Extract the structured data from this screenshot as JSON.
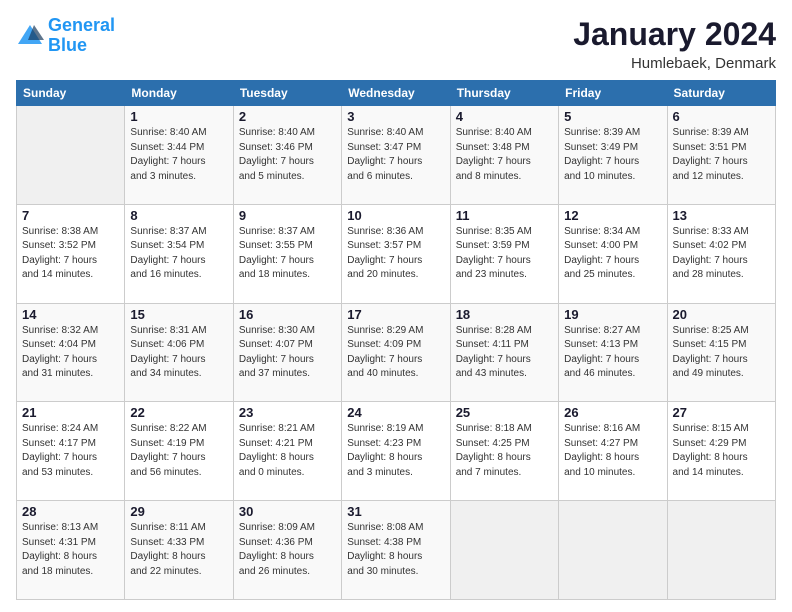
{
  "logo": {
    "line1": "General",
    "line2": "Blue"
  },
  "header": {
    "title": "January 2024",
    "location": "Humlebaek, Denmark"
  },
  "columns": [
    "Sunday",
    "Monday",
    "Tuesday",
    "Wednesday",
    "Thursday",
    "Friday",
    "Saturday"
  ],
  "weeks": [
    [
      {
        "day": "",
        "info": ""
      },
      {
        "day": "1",
        "info": "Sunrise: 8:40 AM\nSunset: 3:44 PM\nDaylight: 7 hours\nand 3 minutes."
      },
      {
        "day": "2",
        "info": "Sunrise: 8:40 AM\nSunset: 3:46 PM\nDaylight: 7 hours\nand 5 minutes."
      },
      {
        "day": "3",
        "info": "Sunrise: 8:40 AM\nSunset: 3:47 PM\nDaylight: 7 hours\nand 6 minutes."
      },
      {
        "day": "4",
        "info": "Sunrise: 8:40 AM\nSunset: 3:48 PM\nDaylight: 7 hours\nand 8 minutes."
      },
      {
        "day": "5",
        "info": "Sunrise: 8:39 AM\nSunset: 3:49 PM\nDaylight: 7 hours\nand 10 minutes."
      },
      {
        "day": "6",
        "info": "Sunrise: 8:39 AM\nSunset: 3:51 PM\nDaylight: 7 hours\nand 12 minutes."
      }
    ],
    [
      {
        "day": "7",
        "info": "Sunrise: 8:38 AM\nSunset: 3:52 PM\nDaylight: 7 hours\nand 14 minutes."
      },
      {
        "day": "8",
        "info": "Sunrise: 8:37 AM\nSunset: 3:54 PM\nDaylight: 7 hours\nand 16 minutes."
      },
      {
        "day": "9",
        "info": "Sunrise: 8:37 AM\nSunset: 3:55 PM\nDaylight: 7 hours\nand 18 minutes."
      },
      {
        "day": "10",
        "info": "Sunrise: 8:36 AM\nSunset: 3:57 PM\nDaylight: 7 hours\nand 20 minutes."
      },
      {
        "day": "11",
        "info": "Sunrise: 8:35 AM\nSunset: 3:59 PM\nDaylight: 7 hours\nand 23 minutes."
      },
      {
        "day": "12",
        "info": "Sunrise: 8:34 AM\nSunset: 4:00 PM\nDaylight: 7 hours\nand 25 minutes."
      },
      {
        "day": "13",
        "info": "Sunrise: 8:33 AM\nSunset: 4:02 PM\nDaylight: 7 hours\nand 28 minutes."
      }
    ],
    [
      {
        "day": "14",
        "info": "Sunrise: 8:32 AM\nSunset: 4:04 PM\nDaylight: 7 hours\nand 31 minutes."
      },
      {
        "day": "15",
        "info": "Sunrise: 8:31 AM\nSunset: 4:06 PM\nDaylight: 7 hours\nand 34 minutes."
      },
      {
        "day": "16",
        "info": "Sunrise: 8:30 AM\nSunset: 4:07 PM\nDaylight: 7 hours\nand 37 minutes."
      },
      {
        "day": "17",
        "info": "Sunrise: 8:29 AM\nSunset: 4:09 PM\nDaylight: 7 hours\nand 40 minutes."
      },
      {
        "day": "18",
        "info": "Sunrise: 8:28 AM\nSunset: 4:11 PM\nDaylight: 7 hours\nand 43 minutes."
      },
      {
        "day": "19",
        "info": "Sunrise: 8:27 AM\nSunset: 4:13 PM\nDaylight: 7 hours\nand 46 minutes."
      },
      {
        "day": "20",
        "info": "Sunrise: 8:25 AM\nSunset: 4:15 PM\nDaylight: 7 hours\nand 49 minutes."
      }
    ],
    [
      {
        "day": "21",
        "info": "Sunrise: 8:24 AM\nSunset: 4:17 PM\nDaylight: 7 hours\nand 53 minutes."
      },
      {
        "day": "22",
        "info": "Sunrise: 8:22 AM\nSunset: 4:19 PM\nDaylight: 7 hours\nand 56 minutes."
      },
      {
        "day": "23",
        "info": "Sunrise: 8:21 AM\nSunset: 4:21 PM\nDaylight: 8 hours\nand 0 minutes."
      },
      {
        "day": "24",
        "info": "Sunrise: 8:19 AM\nSunset: 4:23 PM\nDaylight: 8 hours\nand 3 minutes."
      },
      {
        "day": "25",
        "info": "Sunrise: 8:18 AM\nSunset: 4:25 PM\nDaylight: 8 hours\nand 7 minutes."
      },
      {
        "day": "26",
        "info": "Sunrise: 8:16 AM\nSunset: 4:27 PM\nDaylight: 8 hours\nand 10 minutes."
      },
      {
        "day": "27",
        "info": "Sunrise: 8:15 AM\nSunset: 4:29 PM\nDaylight: 8 hours\nand 14 minutes."
      }
    ],
    [
      {
        "day": "28",
        "info": "Sunrise: 8:13 AM\nSunset: 4:31 PM\nDaylight: 8 hours\nand 18 minutes."
      },
      {
        "day": "29",
        "info": "Sunrise: 8:11 AM\nSunset: 4:33 PM\nDaylight: 8 hours\nand 22 minutes."
      },
      {
        "day": "30",
        "info": "Sunrise: 8:09 AM\nSunset: 4:36 PM\nDaylight: 8 hours\nand 26 minutes."
      },
      {
        "day": "31",
        "info": "Sunrise: 8:08 AM\nSunset: 4:38 PM\nDaylight: 8 hours\nand 30 minutes."
      },
      {
        "day": "",
        "info": ""
      },
      {
        "day": "",
        "info": ""
      },
      {
        "day": "",
        "info": ""
      }
    ]
  ]
}
